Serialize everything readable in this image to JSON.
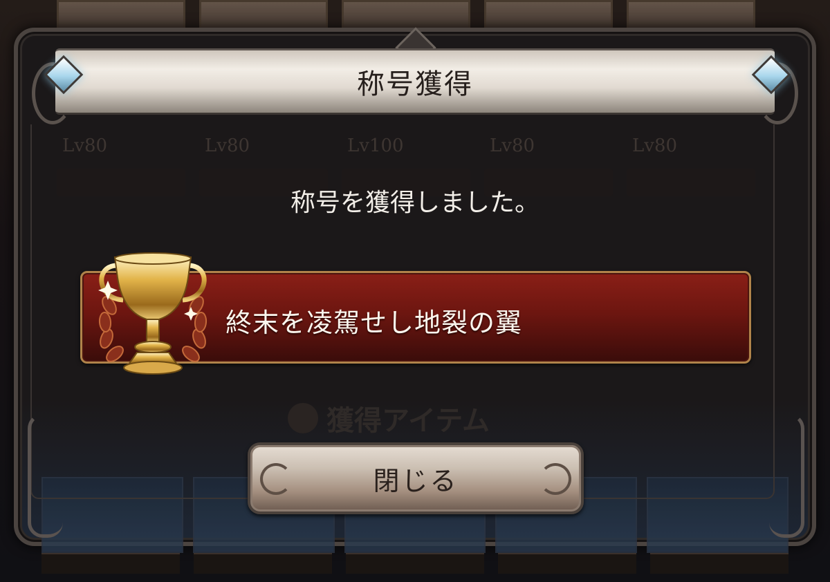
{
  "dialog": {
    "title": "称号獲得",
    "message": "称号を獲得しました。",
    "earned_title": "終末を凌駕せし地裂の翼",
    "close_label": "閉じる",
    "accent_color": "#7a1a13",
    "frame_color": "#4b4440"
  },
  "background": {
    "levels": [
      "Lv80",
      "Lv80",
      "Lv100",
      "Lv80",
      "Lv80"
    ],
    "items_label": "獲得アイテム"
  },
  "icons": {
    "trophy": "trophy-icon",
    "gem": "diamond-gem-icon"
  }
}
